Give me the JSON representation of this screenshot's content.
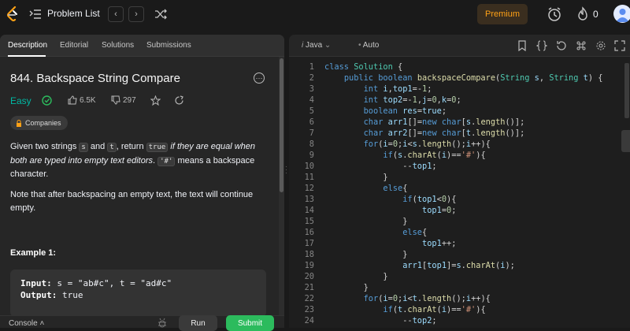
{
  "topbar": {
    "title": "Problem List",
    "premium_label": "Premium",
    "streak_count": "0",
    "prev_glyph": "‹",
    "next_glyph": "›"
  },
  "left_panel": {
    "tabs": [
      "Description",
      "Editorial",
      "Solutions",
      "Submissions"
    ],
    "problem_title": "844. Backspace String Compare",
    "difficulty": "Easy",
    "likes": "6.5K",
    "dislikes": "297",
    "companies_label": "Companies",
    "description": {
      "p1_a": "Given two strings ",
      "p1_s": "s",
      "p1_b": " and ",
      "p1_t": "t",
      "p1_c": ", return ",
      "p1_true": "true",
      "p1_d": " if they are equal when both are typed into empty text editors",
      "p1_e": ". ",
      "p1_hash": "'#'",
      "p1_f": " means a backspace character.",
      "p2": "Note that after backspacing an empty text, the text will continue empty."
    },
    "example_title": "Example 1:",
    "example": {
      "input_label": "Input:",
      "input_value": " s = \"ab#c\", t = \"ad#c\"",
      "output_label": "Output:",
      "output_value": " true"
    },
    "console_label": "Console",
    "run_label": "Run",
    "submit_label": "Submit"
  },
  "editor": {
    "language": "Java",
    "autocomplete": "Auto",
    "lines": [
      "class Solution {",
      "    public boolean backspaceCompare(String s, String t) {",
      "        int i,top1=-1;",
      "        int top2=-1,j=0,k=0;",
      "        boolean res=true;",
      "        char arr1[]=new char[s.length()];",
      "        char arr2[]=new char[t.length()];",
      "        for(i=0;i<s.length();i++){",
      "            if(s.charAt(i)=='#'){",
      "                --top1;",
      "            }",
      "            else{",
      "                if(top1<0){",
      "                    top1=0;",
      "                }",
      "                else{",
      "                    top1++;",
      "                }",
      "                arr1[top1]=s.charAt(i);",
      "            }",
      "        }",
      "        for(i=0;i<t.length();i++){",
      "            if(t.charAt(i)=='#'){",
      "                --top2;"
    ]
  },
  "colors": {
    "accent": "#ffa116",
    "easy": "#00b8a3",
    "submit": "#2cbb5d"
  }
}
